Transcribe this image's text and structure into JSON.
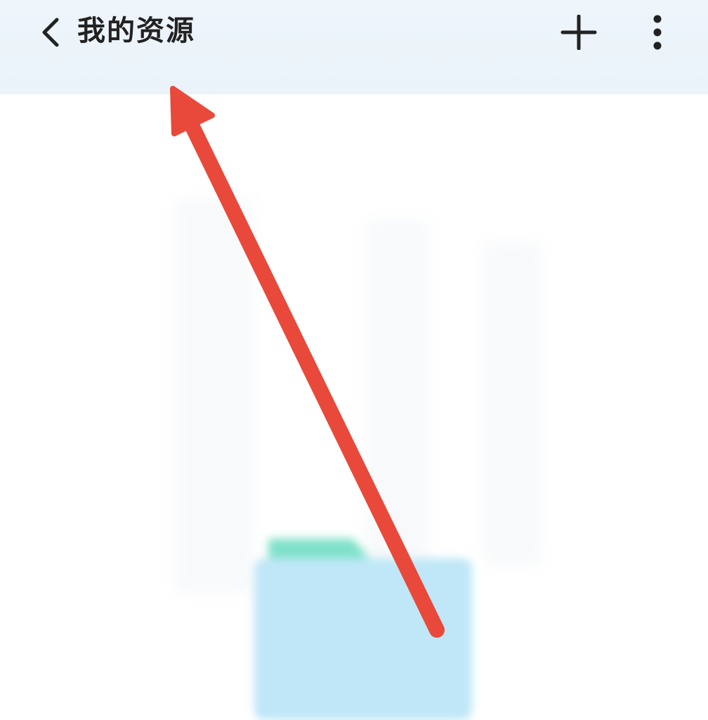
{
  "header": {
    "title": "我的资源",
    "back_icon": "chevron-left-icon",
    "add_icon": "plus-icon",
    "more_icon": "more-vertical-icon"
  },
  "content": {
    "empty_state_icon": "folder-icon"
  },
  "annotation": {
    "type": "arrow",
    "color": "#e8493a"
  },
  "colors": {
    "header_bg": "#eef5fb",
    "icon": "#222222",
    "folder_tab": "#7fe1c9",
    "folder_body": "#bfe7f7"
  }
}
